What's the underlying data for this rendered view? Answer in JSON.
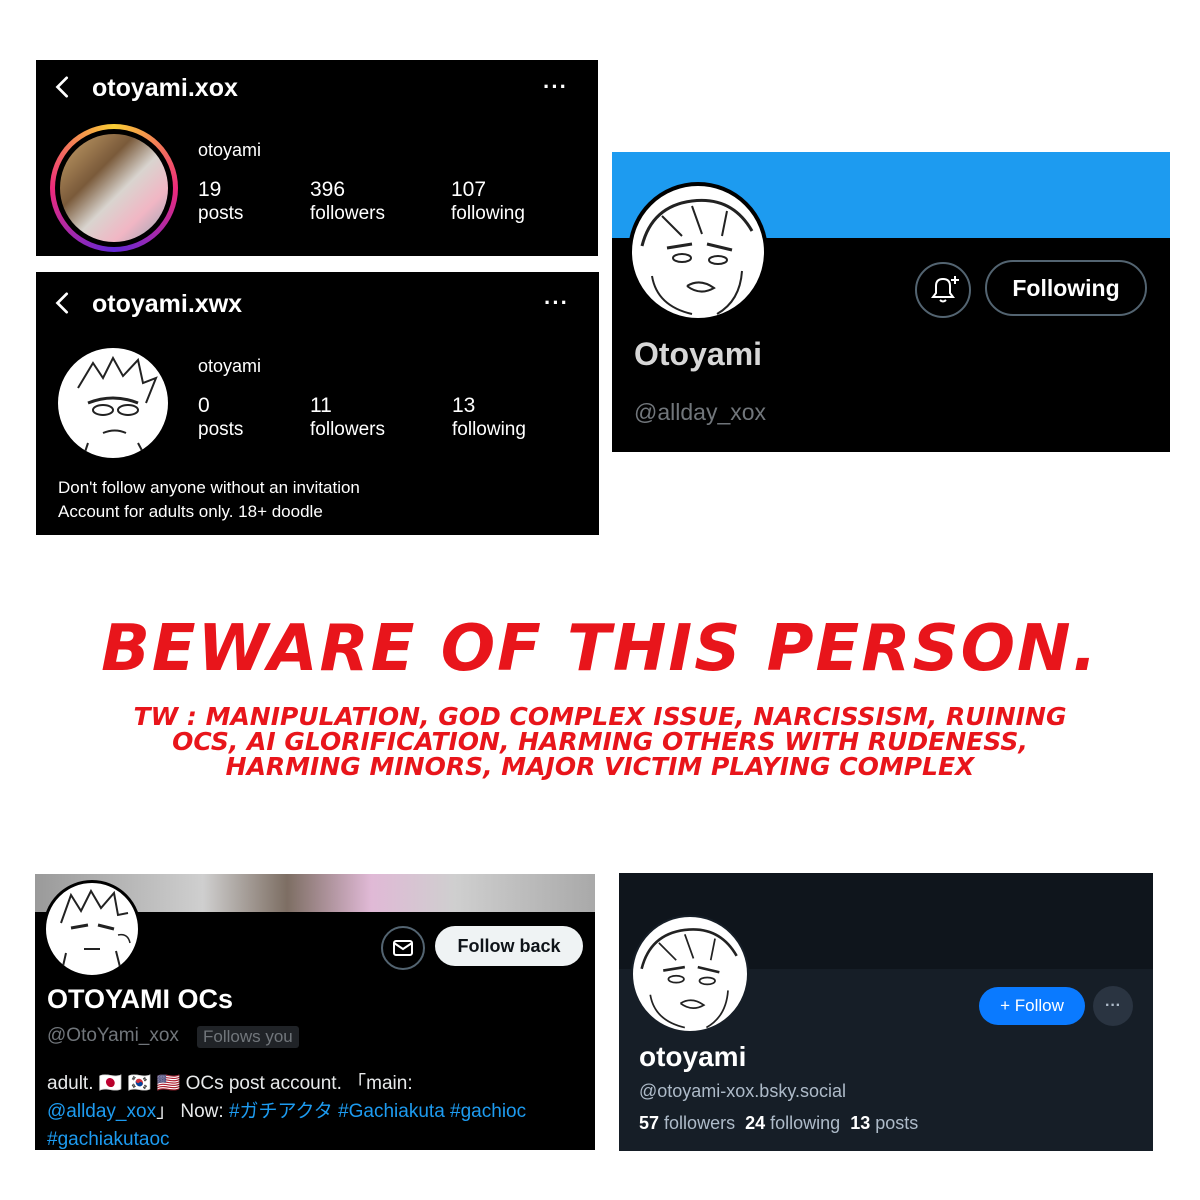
{
  "ig1": {
    "handle": "otoyami.xox",
    "name": "otoyami",
    "posts_count": "19",
    "posts_label": "posts",
    "followers_count": "396",
    "followers_label": "followers",
    "following_count": "107",
    "following_label": "following",
    "menu_glyph": "···"
  },
  "ig2": {
    "handle": "otoyami.xwx",
    "name": "otoyami",
    "posts_count": "0",
    "posts_label": "posts",
    "followers_count": "11",
    "followers_label": "followers",
    "following_count": "13",
    "following_label": "following",
    "menu_glyph": "···",
    "bio_line1": "Don't follow anyone without an invitation",
    "bio_line2": "Account for adults only. 18+ doodle"
  },
  "tw1": {
    "following_label": "Following",
    "display_name": "Otoyami",
    "handle": "@allday_xox",
    "banner_color": "#1d9bf0"
  },
  "warning": {
    "title": "BEWARE OF THIS PERSON.",
    "line1": "TW : MANIPULATION, GOD COMPLEX ISSUE, NARCISSISM, RUINING",
    "line2": "OCS, AI GLORIFICATION, HARMING OTHERS WITH RUDENESS,",
    "line3": "HARMING MINORS,  MAJOR VICTIM PLAYING COMPLEX",
    "color": "#e8151b"
  },
  "tw2": {
    "follow_back_label": "Follow back",
    "display_name": "OTOYAMI OCs",
    "handle": "@OtoYami_xox",
    "follows_you": "Follows you",
    "bio_a": "adult. 🇯🇵 🇰🇷 🇺🇸  OCs post account. 「main:",
    "bio_mention": "@allday_xox",
    "bio_b": "」 Now: ",
    "tag1": "#ガチアクタ",
    "tag2": "#Gachiakuta",
    "tag3": "#gachioc",
    "tag4": "#gachiakutaoc"
  },
  "bsky": {
    "follow_label": "+ Follow",
    "more_glyph": "···",
    "display_name": "otoyami",
    "handle": "@otoyami-xox.bsky.social",
    "followers_count": "57",
    "followers_label": "followers",
    "following_count": "24",
    "following_label": "following",
    "posts_count": "13",
    "posts_label": "posts"
  }
}
